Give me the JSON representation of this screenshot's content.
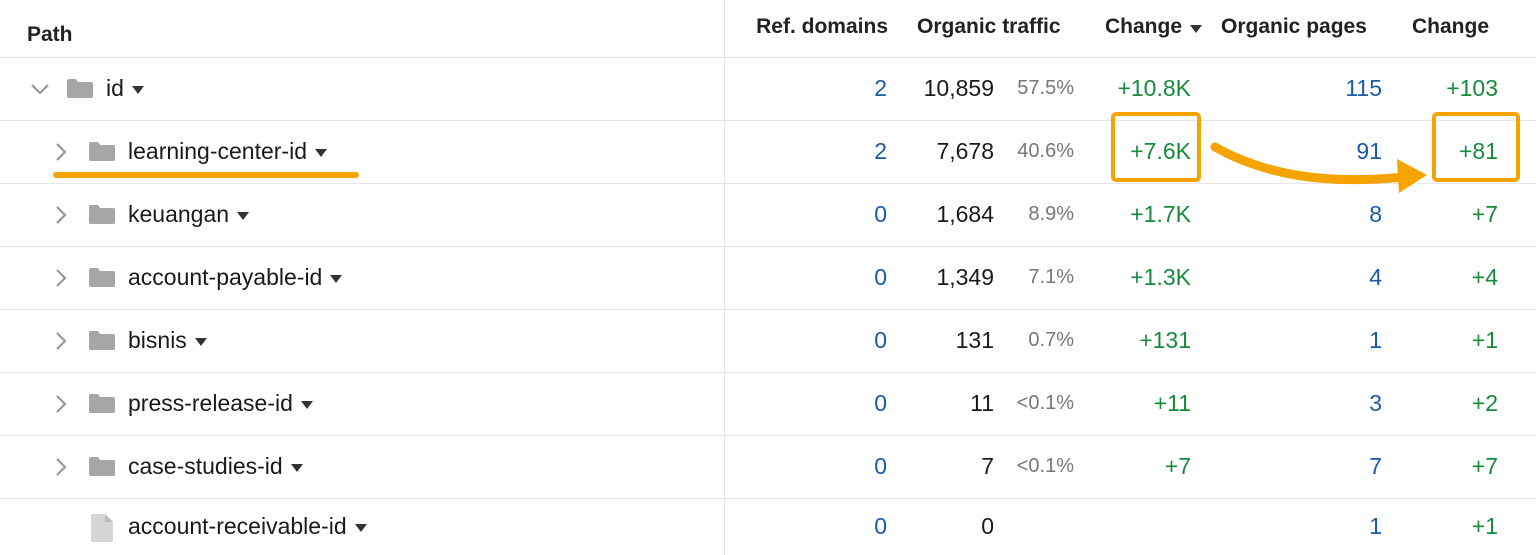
{
  "columns": {
    "path": "Path",
    "ref_domains": "Ref. domains",
    "organic_traffic": "Organic traffic",
    "change": "Change",
    "organic_pages": "Organic pages",
    "change2": "Change"
  },
  "colors": {
    "accent": "#f5a300",
    "link": "#1a5aa8",
    "positive": "#178a3c"
  },
  "rows": [
    {
      "path": "id",
      "ref_domains": "2",
      "traffic": "10,859",
      "share": "57.5%",
      "change": "+10.8K",
      "pages": "115",
      "pages_change": "+103",
      "icon": "folder-icon",
      "expand": "chevron-down-icon"
    },
    {
      "path": "learning-center-id",
      "ref_domains": "2",
      "traffic": "7,678",
      "share": "40.6%",
      "change": "+7.6K",
      "pages": "91",
      "pages_change": "+81",
      "icon": "folder-icon",
      "expand": "chevron-right-icon"
    },
    {
      "path": "keuangan",
      "ref_domains": "0",
      "traffic": "1,684",
      "share": "8.9%",
      "change": "+1.7K",
      "pages": "8",
      "pages_change": "+7",
      "icon": "folder-icon",
      "expand": "chevron-right-icon"
    },
    {
      "path": "account-payable-id",
      "ref_domains": "0",
      "traffic": "1,349",
      "share": "7.1%",
      "change": "+1.3K",
      "pages": "4",
      "pages_change": "+4",
      "icon": "folder-icon",
      "expand": "chevron-right-icon"
    },
    {
      "path": "bisnis",
      "ref_domains": "0",
      "traffic": "131",
      "share": "0.7%",
      "change": "+131",
      "pages": "1",
      "pages_change": "+1",
      "icon": "folder-icon",
      "expand": "chevron-right-icon"
    },
    {
      "path": "press-release-id",
      "ref_domains": "0",
      "traffic": "11",
      "share": "<0.1%",
      "change": "+11",
      "pages": "3",
      "pages_change": "+2",
      "icon": "folder-icon",
      "expand": "chevron-right-icon"
    },
    {
      "path": "case-studies-id",
      "ref_domains": "0",
      "traffic": "7",
      "share": "<0.1%",
      "change": "+7",
      "pages": "7",
      "pages_change": "+7",
      "icon": "folder-icon",
      "expand": "chevron-right-icon"
    },
    {
      "path": "account-receivable-id",
      "ref_domains": "0",
      "traffic": "0",
      "share": "",
      "change": "",
      "pages": "1",
      "pages_change": "+1",
      "icon": "file-icon",
      "expand": ""
    }
  ]
}
